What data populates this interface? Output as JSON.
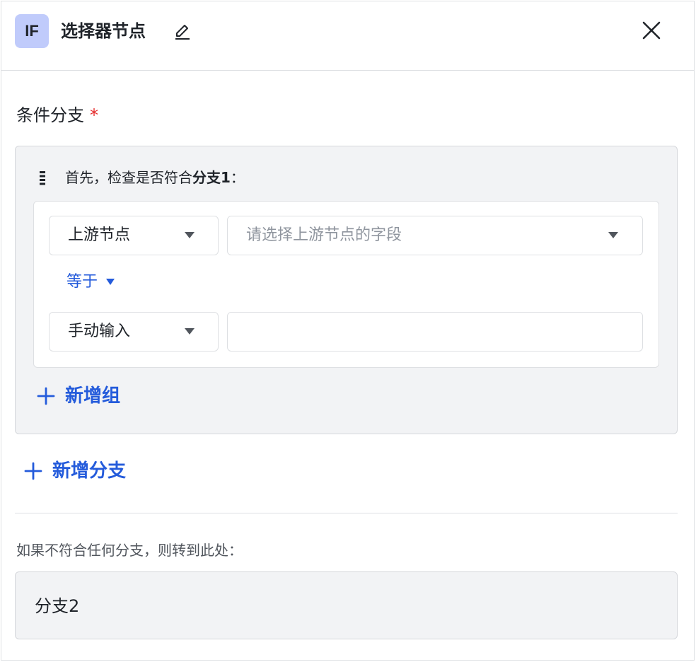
{
  "header": {
    "badge": "IF",
    "title": "选择器节点"
  },
  "section": {
    "label": "条件分支",
    "required_mark": "*"
  },
  "branch": {
    "title_prefix": "首先，检查是否符合",
    "title_name": "分支1",
    "title_suffix": "：",
    "condition": {
      "source_select": "上游节点",
      "field_placeholder": "请选择上游节点的字段",
      "operator": "等于",
      "value_mode_select": "手动输入",
      "value_input": ""
    },
    "add_group_label": "新增组"
  },
  "add_branch_label": "新增分支",
  "fallback": {
    "label": "如果不符合任何分支，则转到此处：",
    "value": "分支2"
  },
  "colors": {
    "accent": "#245bdb",
    "badge_bg": "#c0cbfb",
    "required": "#e52c2c",
    "card_bg": "#f2f3f5"
  }
}
